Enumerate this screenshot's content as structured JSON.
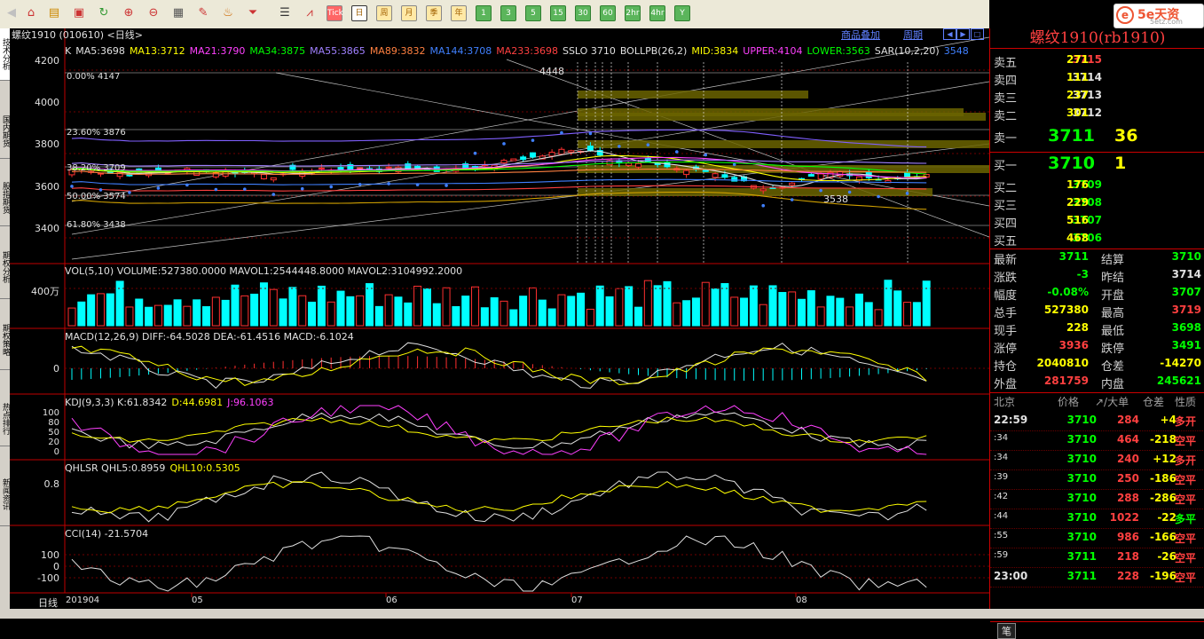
{
  "toolbar": {
    "periods": [
      "日",
      "周",
      "月",
      "季",
      "年"
    ],
    "minutes": [
      "1",
      "3",
      "5",
      "15",
      "30",
      "60",
      "2hr",
      "4hr",
      "Y"
    ],
    "tick_label": "Tick"
  },
  "left_tabs": [
    "技术分析",
    "国内期货",
    "股指期货",
    "期权分析",
    "期权策略",
    "热点排行",
    "新闻资讯"
  ],
  "chart": {
    "symbol_title": "螺纹1910 (010610) <日线>",
    "links": [
      "商品叠加",
      "周期"
    ],
    "price_axis": [
      "4200",
      "4000",
      "3800",
      "3600",
      "3400"
    ],
    "ma_legend": [
      {
        "text": "K",
        "color": "#e0e0e0"
      },
      {
        "text": "MA5:3698",
        "color": "#e0e0e0"
      },
      {
        "text": "MA13:3712",
        "color": "#ffff00"
      },
      {
        "text": "MA21:3790",
        "color": "#ff40ff"
      },
      {
        "text": "MA34:3875",
        "color": "#00ff00"
      },
      {
        "text": "MA55:3865",
        "color": "#a080ff"
      },
      {
        "text": "MA89:3832",
        "color": "#ff8040"
      },
      {
        "text": "MA144:3708",
        "color": "#4080ff"
      },
      {
        "text": "MA233:3698",
        "color": "#ff4040"
      },
      {
        "text": "SSLO 3710",
        "color": "#e0e0e0"
      },
      {
        "text": "BOLLPB(26,2)",
        "color": "#e0e0e0"
      },
      {
        "text": "MID:3834",
        "color": "#ffff00"
      },
      {
        "text": "UPPER:4104",
        "color": "#ff40ff"
      },
      {
        "text": "LOWER:3563",
        "color": "#00ff00"
      },
      {
        "text": "SAR(10,2,20)",
        "color": "#e0e0e0"
      },
      {
        "text": "3548",
        "color": "#4080ff"
      }
    ],
    "fib_labels": [
      "0.00% 4147",
      "23.60% 3876",
      "38.20% 3709",
      "50.00% 3574",
      "61.80% 3438"
    ],
    "high_mark": "4448",
    "low_mark": "3538",
    "cycle_marks": [
      "0",
      "1",
      "2",
      "3",
      "5",
      "8",
      "13",
      "21",
      "34"
    ],
    "vol": {
      "title": "VOL(5,10) VOLUME:527380.0000 MAVOL1:2544448.8000 MAVOL2:3104992.2000",
      "axis": "400万"
    },
    "macd": {
      "title": "MACD(12,26,9) DIFF:-64.5028 DEA:-61.4516 MACD:-6.1024",
      "axis": "0"
    },
    "kdj": {
      "title_k": "KDJ(9,3,3) K:61.8342",
      "title_d": "D:44.6981",
      "title_j": "J:96.1063",
      "axis": [
        "100",
        "80",
        "50",
        "20",
        "0"
      ]
    },
    "qhlsr": {
      "title_a": "QHLSR QHL5:0.8959",
      "title_b": "QHL10:0.5305",
      "axis": "0.8"
    },
    "cci": {
      "title": "CCI(14) -21.5704",
      "axis": [
        "100",
        "0",
        "-100"
      ]
    },
    "date_axis": {
      "label": "日线",
      "dates": [
        "201904",
        "05",
        "06",
        "07",
        "08"
      ]
    }
  },
  "panel": {
    "title": "螺纹1910(rb1910)",
    "asks": [
      {
        "label": "卖五",
        "price": "3715",
        "vol": "271"
      },
      {
        "label": "卖四",
        "price": "3714",
        "vol": "111"
      },
      {
        "label": "卖三",
        "price": "3713",
        "vol": "237"
      },
      {
        "label": "卖二",
        "price": "3712",
        "vol": "301"
      },
      {
        "label": "卖一",
        "price": "3711",
        "vol": "36"
      }
    ],
    "bids": [
      {
        "label": "买一",
        "price": "3710",
        "vol": "1"
      },
      {
        "label": "买二",
        "price": "3709",
        "vol": "176"
      },
      {
        "label": "买三",
        "price": "3708",
        "vol": "229"
      },
      {
        "label": "买四",
        "price": "3707",
        "vol": "516"
      },
      {
        "label": "买五",
        "price": "3706",
        "vol": "468"
      }
    ],
    "stats": [
      {
        "l1": "最新",
        "v1": "3711",
        "c1": "#00ff00",
        "l2": "结算",
        "v2": "3710",
        "c2": "#00ff00"
      },
      {
        "l1": "涨跌",
        "v1": "-3",
        "c1": "#00ff00",
        "l2": "昨结",
        "v2": "3714",
        "c2": "#e0e0e0"
      },
      {
        "l1": "幅度",
        "v1": "-0.08%",
        "c1": "#00ff00",
        "l2": "开盘",
        "v2": "3707",
        "c2": "#00ff00"
      },
      {
        "l1": "总手",
        "v1": "527380",
        "c1": "#ffff00",
        "l2": "最高",
        "v2": "3719",
        "c2": "#ff4040"
      },
      {
        "l1": "现手",
        "v1": "228",
        "c1": "#ffff00",
        "l2": "最低",
        "v2": "3698",
        "c2": "#00ff00"
      },
      {
        "l1": "涨停",
        "v1": "3936",
        "c1": "#ff4040",
        "l2": "跌停",
        "v2": "3491",
        "c2": "#00ff00"
      },
      {
        "l1": "持仓",
        "v1": "2040810",
        "c1": "#ffff00",
        "l2": "仓差",
        "v2": "-14270",
        "c2": "#ffff00"
      },
      {
        "l1": "外盘",
        "v1": "281759",
        "c1": "#ff4040",
        "l2": "内盘",
        "v2": "245621",
        "c2": "#00ff00"
      }
    ],
    "ticks_header": [
      "北京",
      "价格",
      "↗/大单",
      "仓差",
      "性质"
    ],
    "ticks": [
      {
        "t": "22:59",
        "p": "3710",
        "v": "284",
        "d": "+4",
        "n": "多开",
        "pc": "#00ff00",
        "nc": "#ff4040"
      },
      {
        "t": ":34",
        "p": "3710",
        "v": "464",
        "d": "-218",
        "n": "空平",
        "pc": "#00ff00",
        "nc": "#ff4040"
      },
      {
        "t": ":34",
        "p": "3710",
        "v": "240",
        "d": "+12",
        "n": "多开",
        "pc": "#00ff00",
        "nc": "#ff4040"
      },
      {
        "t": ":39",
        "p": "3710",
        "v": "250",
        "d": "-186",
        "n": "空平",
        "pc": "#00ff00",
        "nc": "#ff4040"
      },
      {
        "t": ":42",
        "p": "3710",
        "v": "288",
        "d": "-286",
        "n": "空平",
        "pc": "#00ff00",
        "nc": "#ff4040"
      },
      {
        "t": ":44",
        "p": "3710",
        "v": "1022",
        "d": "-22",
        "n": "多平",
        "pc": "#00ff00",
        "nc": "#00ff00"
      },
      {
        "t": ":55",
        "p": "3710",
        "v": "986",
        "d": "-166",
        "n": "空平",
        "pc": "#00ff00",
        "nc": "#ff4040"
      },
      {
        "t": ":59",
        "p": "3711",
        "v": "218",
        "d": "-26",
        "n": "空平",
        "pc": "#00ff00",
        "nc": "#ff4040"
      },
      {
        "t": "23:00",
        "p": "3711",
        "v": "228",
        "d": "-196",
        "n": "空平",
        "pc": "#00ff00",
        "nc": "#ff4040"
      }
    ],
    "bottom_tab": "笔"
  },
  "logo": {
    "text": "5e天资",
    "sub": "5etz.com"
  }
}
